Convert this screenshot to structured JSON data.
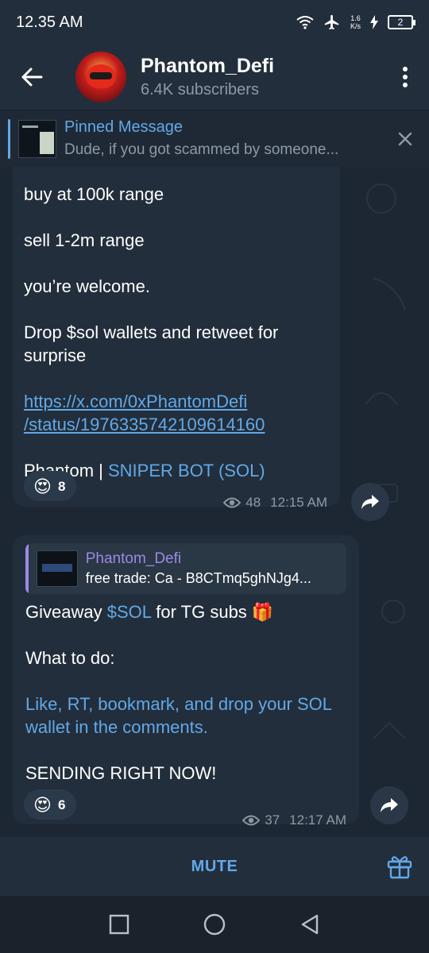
{
  "status_bar": {
    "time": "12.35 AM",
    "speed_value": "1.6",
    "speed_unit": "K/s",
    "battery": "2",
    "icons": [
      "wifi-icon",
      "airplane-icon",
      "charging-icon",
      "battery-icon"
    ]
  },
  "header": {
    "channel_name": "Phantom_Defi",
    "subscribers": "6.4K subscribers"
  },
  "pinned": {
    "title": "Pinned Message",
    "preview": "Dude, if you got scammed by someone..."
  },
  "messages": [
    {
      "lines": [
        "buy at 100k range",
        "sell 1-2m range",
        "you’re welcome.",
        "Drop $sol wallets and retweet for surprise"
      ],
      "link_line1": "https://x.com/0xPhantomDefi",
      "link_line2": "/status/1976335742109614160",
      "signature_prefix": "Phantom | ",
      "signature_link": "SNIPER BOT (SOL)",
      "reaction_emoji": "😍",
      "reaction_count": "8",
      "views": "48",
      "time": "12:15 AM"
    },
    {
      "reply_name": "Phantom_Defi",
      "reply_preview": "free trade:  Ca - B8CTmq5ghNJg4...",
      "line1_prefix": "Giveaway ",
      "line1_accent": "$SOL",
      "line1_suffix": " for TG subs 🎁",
      "line2": "What to do:",
      "line3": "Like, RT, bookmark, and drop your SOL wallet in the comments.",
      "line4": "SENDING RIGHT NOW!",
      "reaction_emoji": "😍",
      "reaction_count": "6",
      "views": "37",
      "time": "12:17 AM"
    }
  ],
  "bottom": {
    "mute_label": "MUTE"
  },
  "colors": {
    "accent": "#62a8e8",
    "reply_accent": "#9b8ae6",
    "background": "#1c2733",
    "bubble": "#222e3b"
  }
}
